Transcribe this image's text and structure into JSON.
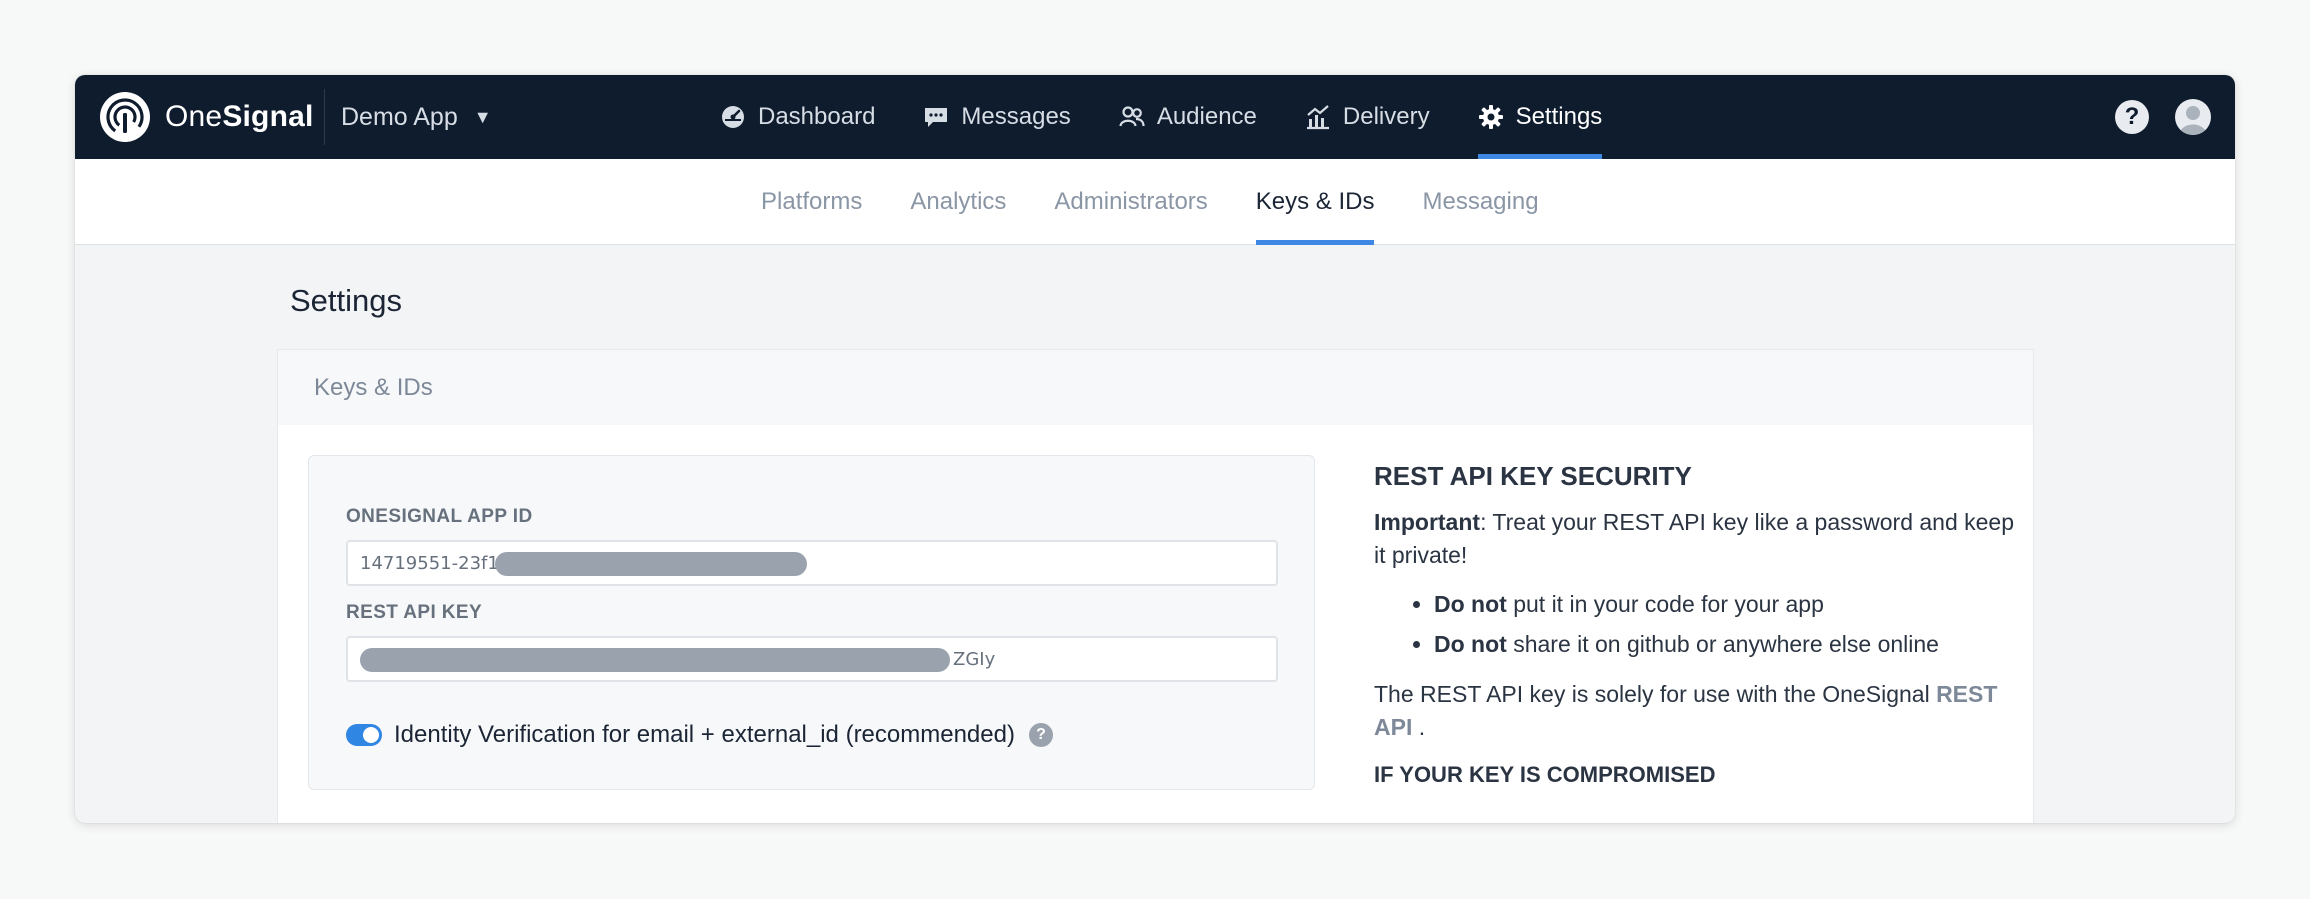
{
  "brand": {
    "name_part1": "One",
    "name_part2": "Signal"
  },
  "app_selector": {
    "label": "Demo App",
    "caret": "▼"
  },
  "nav": {
    "items": [
      {
        "label": "Dashboard",
        "icon": "dashboard-icon"
      },
      {
        "label": "Messages",
        "icon": "messages-icon"
      },
      {
        "label": "Audience",
        "icon": "audience-icon"
      },
      {
        "label": "Delivery",
        "icon": "delivery-icon"
      },
      {
        "label": "Settings",
        "icon": "gear-icon",
        "active": true
      }
    ],
    "help_label": "?"
  },
  "subnav": {
    "items": [
      {
        "label": "Platforms"
      },
      {
        "label": "Analytics"
      },
      {
        "label": "Administrators"
      },
      {
        "label": "Keys & IDs",
        "active": true
      },
      {
        "label": "Messaging"
      }
    ]
  },
  "page": {
    "title": "Settings"
  },
  "card": {
    "header": "Keys & IDs",
    "app_id": {
      "label": "ONESIGNAL APP ID",
      "visible_prefix": "14719551-23f1"
    },
    "rest_key": {
      "label": "REST API KEY",
      "visible_suffix": "ZGIy"
    },
    "identity_toggle": {
      "label": "Identity Verification for email + external_id (recommended)",
      "enabled": true,
      "help": "?"
    }
  },
  "info": {
    "heading": "REST API KEY SECURITY",
    "important_label": "Important",
    "important_text": ": Treat your REST API key like a password and keep it private!",
    "bullets": [
      {
        "bold": "Do not",
        "text": " put it in your code for your app"
      },
      {
        "bold": "Do not",
        "text": " share it on github or anywhere else online"
      }
    ],
    "usage_text": "The REST API key is solely for use with the OneSignal ",
    "usage_link": "REST API",
    "usage_end": " .",
    "compromised_heading": "IF YOUR KEY IS COMPROMISED"
  },
  "colors": {
    "nav_bg": "#0f1c2e",
    "accent": "#3e87e2",
    "toggle_on": "#2f86e3"
  }
}
